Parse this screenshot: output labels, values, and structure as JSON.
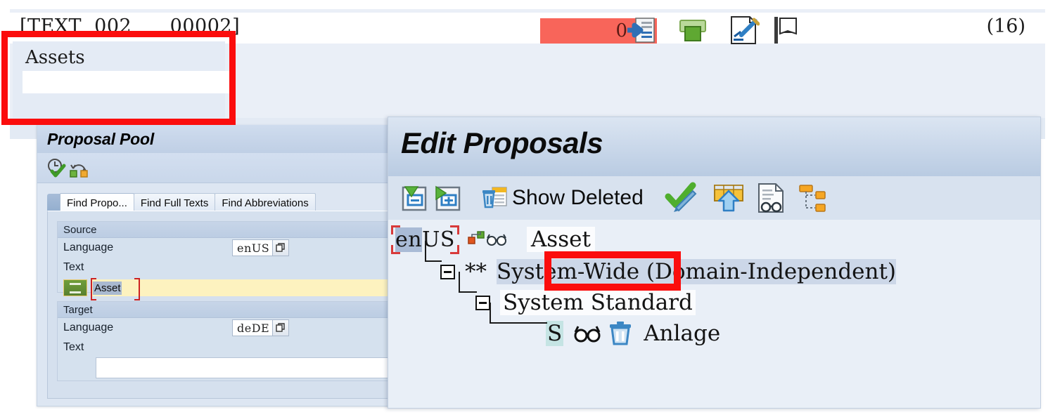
{
  "app": {
    "top_bar": {
      "code_text": "[TEXT  002      00002]",
      "count_text": "(16)",
      "zero_value": "0",
      "icons": [
        {
          "name": "enter-icon",
          "label": "Enter"
        },
        {
          "name": "print-icon",
          "label": "Print"
        },
        {
          "name": "signature-icon",
          "label": "Signature"
        },
        {
          "name": "flag-icon",
          "label": "Flag"
        }
      ]
    },
    "assets_card": {
      "label": "Assets",
      "input_value": "",
      "input_placeholder": ""
    }
  },
  "proposal_pool": {
    "title": "Proposal Pool",
    "toolbar": {
      "icons": [
        {
          "name": "check-clock-icon",
          "label": "Check"
        },
        {
          "name": "swap-languages-icon",
          "label": "Swap Languages"
        }
      ]
    },
    "tabs": [
      {
        "label": "Find Propo...",
        "active": true
      },
      {
        "label": "Find Full Texts",
        "active": false
      },
      {
        "label": "Find Abbreviations",
        "active": false
      }
    ],
    "source": {
      "group_label": "Source",
      "language_label": "Language",
      "language_value": "enUS",
      "text_label": "Text",
      "operator": "=",
      "text_value": "Asset"
    },
    "target": {
      "group_label": "Target",
      "language_label": "Language",
      "language_value": "deDE",
      "text_label": "Text",
      "text_value": ""
    }
  },
  "edit_proposals": {
    "title": "Edit Proposals",
    "toolbar": {
      "collapse_label": "Collapse All",
      "expand_label": "Expand All",
      "show_deleted_label": "Show Deleted",
      "icons": [
        {
          "name": "collapse-all-icon",
          "label": "Collapse All"
        },
        {
          "name": "expand-all-icon",
          "label": "Expand All"
        },
        {
          "name": "trash-list-icon",
          "label": "Show Deleted"
        },
        {
          "name": "approve-edit-icon",
          "label": "Approve / Edit"
        },
        {
          "name": "upload-table-icon",
          "label": "Upload"
        },
        {
          "name": "document-read-icon",
          "label": "Read Document"
        },
        {
          "name": "hierarchy-icon",
          "label": "Hierarchy"
        }
      ]
    },
    "tree": {
      "root": {
        "language": "enUS",
        "language_highlight": "en",
        "term": "Asset",
        "icons": [
          {
            "name": "context-link-icon",
            "label": "Context"
          },
          {
            "name": "glasses-icon",
            "label": "Read Only"
          }
        ]
      },
      "nodes": [
        {
          "prefix": "**",
          "label": "System-Wide  (Domain-Independent)",
          "indent": 1
        },
        {
          "prefix": "",
          "label": "System Standard",
          "indent": 2
        },
        {
          "prefix": "S",
          "label": "Anlage",
          "indent": 3,
          "icons": [
            {
              "name": "glasses-icon",
              "label": "Read Only"
            },
            {
              "name": "trash-icon",
              "label": "Delete"
            }
          ]
        }
      ]
    }
  },
  "annotations": [
    {
      "name": "assets-field-highlight",
      "color": "#fb0d0d"
    },
    {
      "name": "asset-term-highlight",
      "color": "#fb0d0d"
    }
  ]
}
